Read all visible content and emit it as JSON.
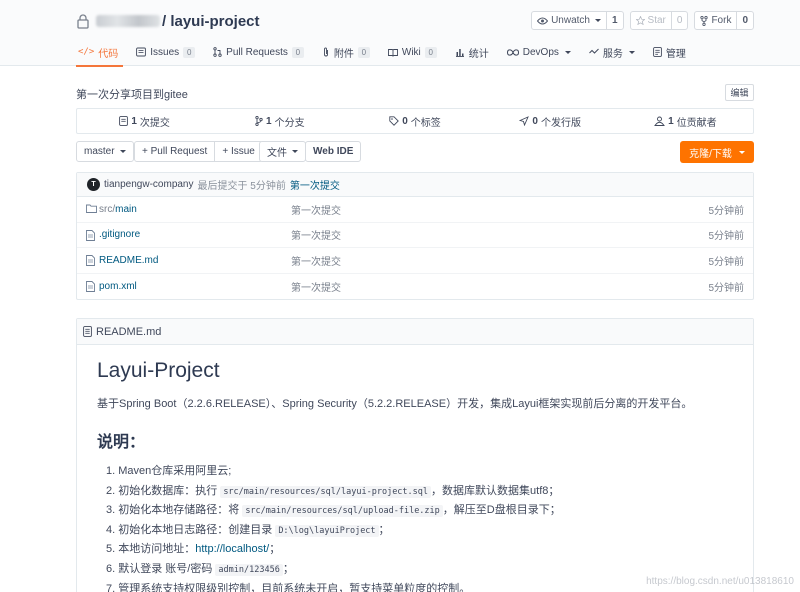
{
  "repo": {
    "name": "/ layui-project"
  },
  "actions": [
    {
      "label": "Unwatch",
      "count": "1",
      "icon": "eye-icon",
      "dropdown": true,
      "disabled": false
    },
    {
      "label": "Star",
      "count": "0",
      "icon": "star-icon",
      "dropdown": false,
      "disabled": true
    },
    {
      "label": "Fork",
      "count": "0",
      "icon": "fork-icon",
      "dropdown": false,
      "disabled": false
    }
  ],
  "tabs": [
    {
      "label": "代码",
      "icon": "code-icon",
      "badge": null,
      "active": true
    },
    {
      "label": "Issues",
      "icon": "issues-icon",
      "badge": "0"
    },
    {
      "label": "Pull Requests",
      "icon": "pull-request-icon",
      "badge": "0"
    },
    {
      "label": "附件",
      "icon": "attachment-icon",
      "badge": "0"
    },
    {
      "label": "Wiki",
      "icon": "wiki-icon",
      "badge": "0"
    },
    {
      "label": "统计",
      "icon": "stats-icon",
      "badge": null
    },
    {
      "label": "DevOps",
      "icon": "devops-icon",
      "badge": null,
      "dropdown": true
    },
    {
      "label": "服务",
      "icon": "service-icon",
      "badge": null,
      "dropdown": true
    },
    {
      "label": "管理",
      "icon": "manage-icon",
      "badge": null
    }
  ],
  "description": "第一次分享项目到gitee",
  "edit_label": "编辑",
  "stats": [
    {
      "count": "1",
      "label": "次提交",
      "icon": "commit-icon"
    },
    {
      "count": "1",
      "label": "个分支",
      "icon": "branch-icon"
    },
    {
      "count": "0",
      "label": "个标签",
      "icon": "tag-icon"
    },
    {
      "count": "0",
      "label": "个发行版",
      "icon": "release-icon"
    },
    {
      "count": "1",
      "label": "位贡献者",
      "icon": "contributor-icon"
    }
  ],
  "controls": {
    "branch": "master",
    "pull_request": "+ Pull Request",
    "issue": "+ Issue",
    "file": "文件",
    "webide": "Web IDE",
    "clone": "克隆/下载"
  },
  "commit": {
    "avatar_letter": "T",
    "author": "tianpengw-company",
    "meta": "最后提交于 5分钟前",
    "message": "第一次提交"
  },
  "files": [
    {
      "name_dim": "src/",
      "name": "main",
      "type": "folder",
      "message": "第一次提交",
      "time": "5分钟前"
    },
    {
      "name_dim": "",
      "name": ".gitignore",
      "type": "file",
      "message": "第一次提交",
      "time": "5分钟前"
    },
    {
      "name_dim": "",
      "name": "README.md",
      "type": "file",
      "message": "第一次提交",
      "time": "5分钟前"
    },
    {
      "name_dim": "",
      "name": "pom.xml",
      "type": "file",
      "message": "第一次提交",
      "time": "5分钟前"
    }
  ],
  "readme": {
    "filename": "README.md",
    "title": "Layui-Project",
    "intro": "基于Spring Boot（2.2.6.RELEASE）、Spring Security（5.2.2.RELEASE）开发，集成Layui框架实现前后分离的开发平台。",
    "heading": "说明：",
    "items": [
      {
        "num": "1.",
        "pre": "Maven仓库采用阿里云;",
        "code": "",
        "post": "",
        "link": ""
      },
      {
        "num": "2.",
        "pre": "初始化数据库：执行 ",
        "code": "src/main/resources/sql/layui-project.sql",
        "post": "，数据库默认数据集utf8；",
        "link": ""
      },
      {
        "num": "3.",
        "pre": "初始化本地存储路径：将 ",
        "code": "src/main/resources/sql/upload-file.zip",
        "post": "，解压至D盘根目录下；",
        "link": ""
      },
      {
        "num": "4.",
        "pre": "初始化本地日志路径：创建目录 ",
        "code": "D:\\log\\layuiProject",
        "post": "；",
        "link": ""
      },
      {
        "num": "5.",
        "pre": "本地访问地址：",
        "code": "",
        "post": "；",
        "link": "http://localhost/"
      },
      {
        "num": "6.",
        "pre": "默认登录 账号/密码 ",
        "code": "admin/123456",
        "post": "；",
        "link": ""
      },
      {
        "num": "7.",
        "pre": "管理系统支持权限级别控制，目前系统未开启，暂支持菜单粒度的控制。",
        "code": "",
        "post": "",
        "link": ""
      }
    ]
  },
  "watermark": "https://blog.csdn.net/u013818610"
}
